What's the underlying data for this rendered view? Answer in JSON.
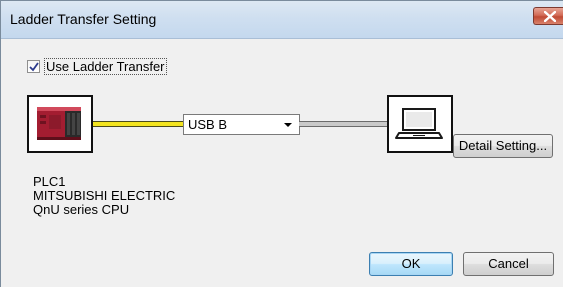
{
  "window": {
    "title": "Ladder Transfer Setting"
  },
  "options": {
    "use_ladder_transfer_label": "Use Ladder Transfer",
    "use_ladder_transfer_checked": true
  },
  "connection": {
    "interface_selected": "USB B",
    "detail_setting_label": "Detail Setting..."
  },
  "plc": {
    "name": "PLC1",
    "manufacturer": "MITSUBISHI ELECTRIC",
    "model": "QnU series CPU"
  },
  "buttons": {
    "ok_label": "OK",
    "cancel_label": "Cancel"
  },
  "icons": {
    "close": "close-icon",
    "plc": "plc-module-icon",
    "computer": "laptop-icon",
    "dropdown": "chevron-down-icon",
    "check": "checkmark-icon"
  },
  "colors": {
    "titlebar": "#cfdff0",
    "close_button": "#c94f39",
    "cable_plc": "#f3e41f",
    "cable_pc": "#c9c9c9",
    "plc_body": "#b0263a"
  }
}
